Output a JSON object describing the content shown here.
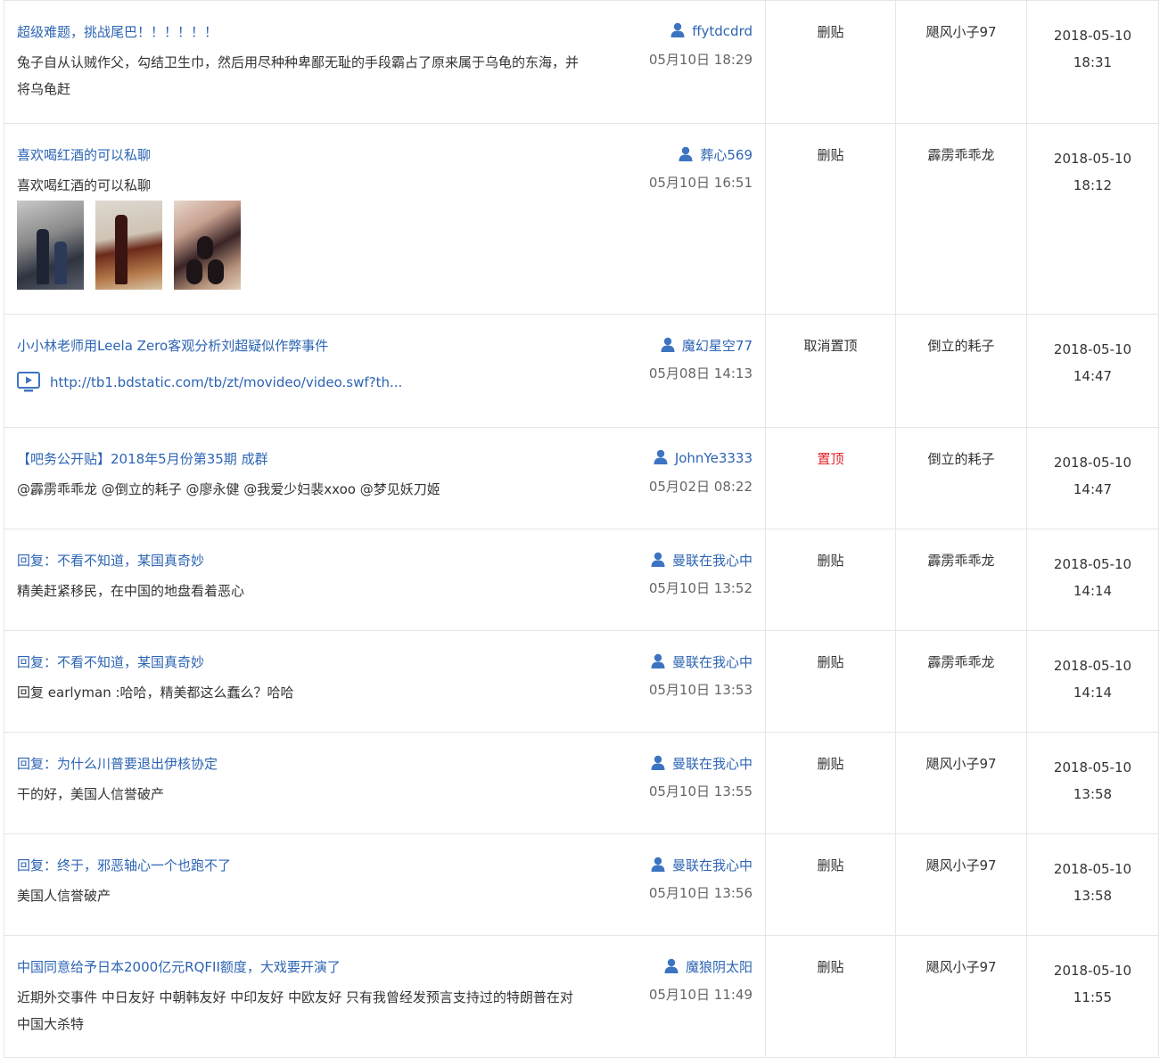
{
  "rows": [
    {
      "title": "超级难题，挑战尾巴！！！！！！",
      "body": "兔子自从认贼作父，勾结卫生巾，然后用尽种种卑鄙无耻的手段霸占了原来属于乌龟的东海，并将乌龟赶",
      "author": "ffytdcdrd",
      "post_time": "05月10日 18:29",
      "operation": "删贴",
      "operator": "飓风小子97",
      "op_date": "2018-05-10",
      "op_time": "18:31"
    },
    {
      "title": "喜欢喝红酒的可以私聊",
      "body": "喜欢喝红酒的可以私聊",
      "author": "葬心569",
      "post_time": "05月10日 16:51",
      "operation": "删贴",
      "operator": "霹雳乖乖龙",
      "op_date": "2018-05-10",
      "op_time": "18:12",
      "images": [
        "wine-photo-1",
        "wine-photo-2",
        "wine-photo-3"
      ]
    },
    {
      "title": "小小林老师用Leela Zero客观分析刘超疑似作弊事件",
      "video_link": "http://tb1.bdstatic.com/tb/zt/movideo/video.swf?th...",
      "author": "魔幻星空77",
      "post_time": "05月08日 14:13",
      "operation": "取消置顶",
      "operator": "倒立的耗子",
      "op_date": "2018-05-10",
      "op_time": "14:47"
    },
    {
      "title": "【吧务公开贴】2018年5月份第35期 成群",
      "body": "@霹雳乖乖龙 @倒立的耗子 @廖永健 @我爱少妇裴xxoo @梦见妖刀姬",
      "author": "JohnYe3333",
      "post_time": "05月02日 08:22",
      "operation": "置顶",
      "operation_color": "#e0242b",
      "operator": "倒立的耗子",
      "op_date": "2018-05-10",
      "op_time": "14:47"
    },
    {
      "title": "回复：不看不知道，某国真奇妙",
      "body": "精美赶紧移民，在中国的地盘看着恶心",
      "author": "曼联在我心中",
      "post_time": "05月10日 13:52",
      "operation": "删贴",
      "operator": "霹雳乖乖龙",
      "op_date": "2018-05-10",
      "op_time": "14:14"
    },
    {
      "title": "回复：不看不知道，某国真奇妙",
      "body": "回复 earlyman :哈哈，精美都这么蠢么？哈哈",
      "author": "曼联在我心中",
      "post_time": "05月10日 13:53",
      "operation": "删贴",
      "operator": "霹雳乖乖龙",
      "op_date": "2018-05-10",
      "op_time": "14:14"
    },
    {
      "title": "回复：为什么川普要退出伊核协定",
      "body": "干的好，美国人信誉破产",
      "author": "曼联在我心中",
      "post_time": "05月10日 13:55",
      "operation": "删贴",
      "operator": "飓风小子97",
      "op_date": "2018-05-10",
      "op_time": "13:58"
    },
    {
      "title": "回复：终于，邪恶轴心一个也跑不了",
      "body": "美国人信誉破产",
      "author": "曼联在我心中",
      "post_time": "05月10日 13:56",
      "operation": "删贴",
      "operator": "飓风小子97",
      "op_date": "2018-05-10",
      "op_time": "13:58"
    },
    {
      "title": "中国同意给予日本2000亿元RQFII额度，大戏要开演了",
      "body": "近期外交事件 中日友好 中朝韩友好 中印友好 中欧友好 只有我曾经发预言支持过的特朗普在对中国大杀特",
      "author": "魔狼阴太阳",
      "post_time": "05月10日 11:49",
      "operation": "删贴",
      "operator": "飓风小子97",
      "op_date": "2018-05-10",
      "op_time": "11:55"
    }
  ],
  "colors": {
    "link": "#2d64b3",
    "text": "#333333",
    "muted": "#666666",
    "highlight": "#e0242b",
    "border": "#e6e6e6"
  },
  "icons": {
    "author": "user-icon",
    "video": "video-icon"
  }
}
